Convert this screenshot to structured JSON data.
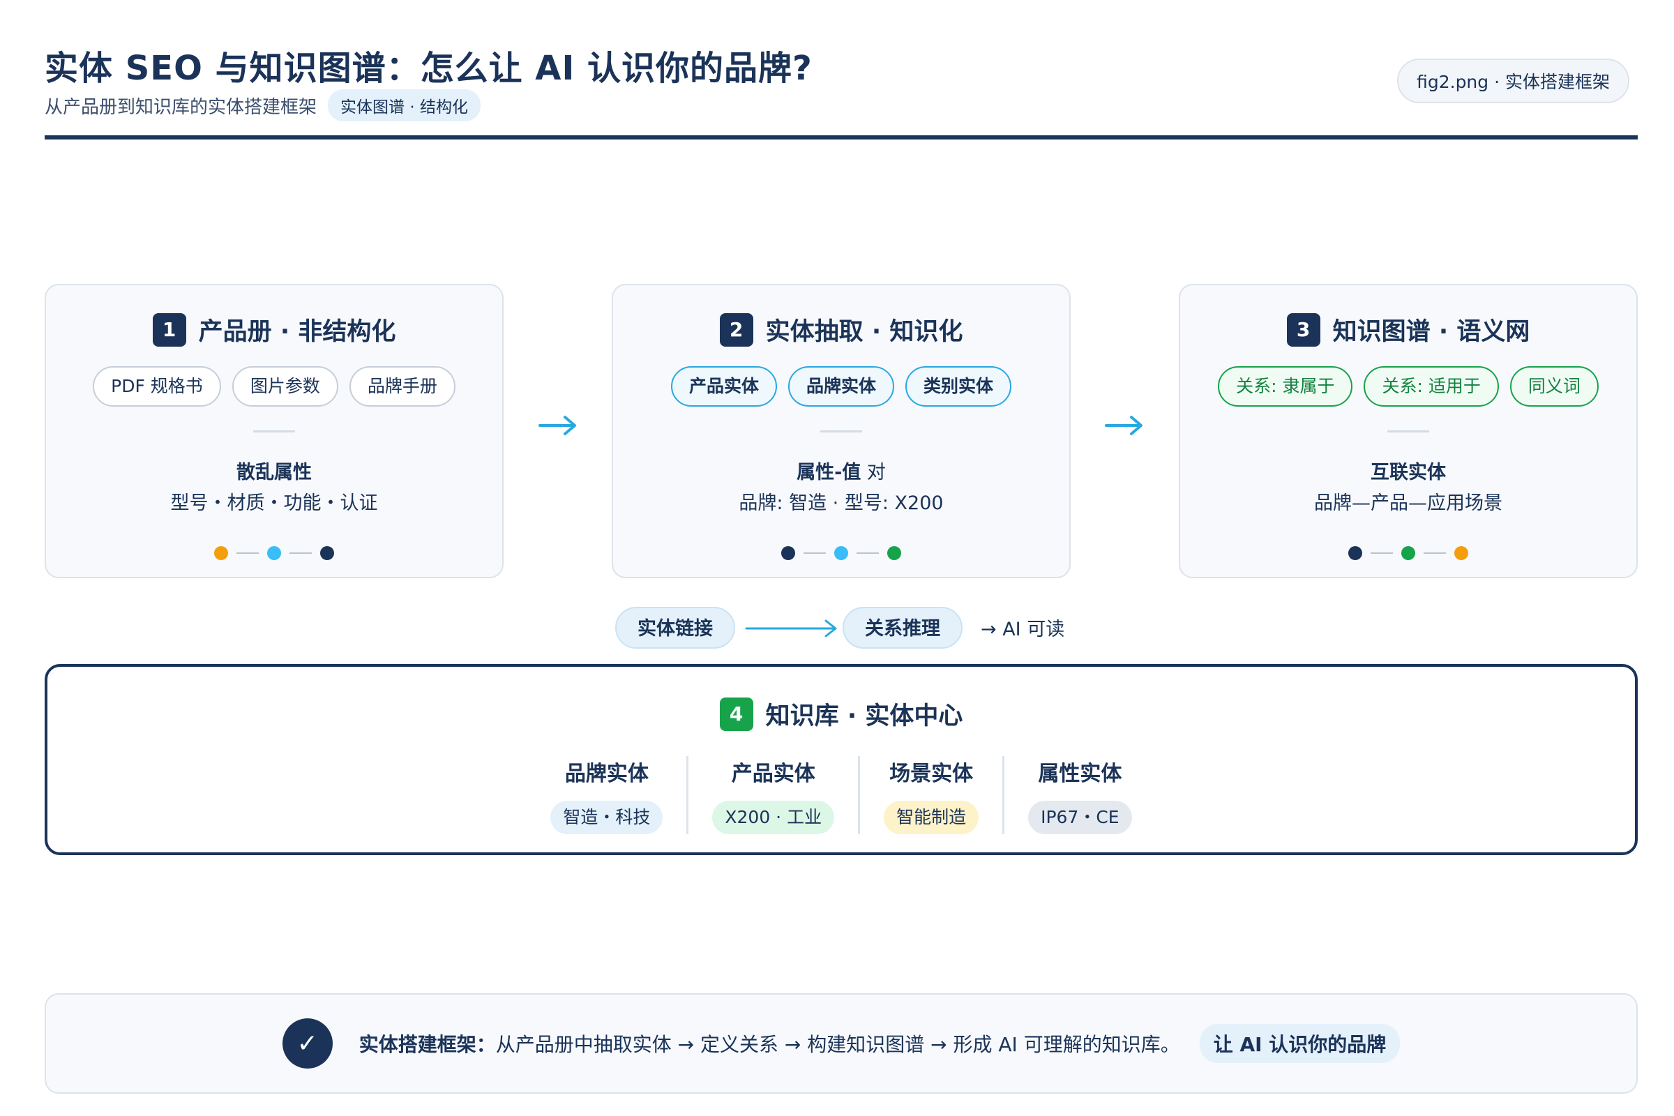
{
  "header": {
    "title": "实体 SEO 与知识图谱：怎么让 AI 认识你的品牌?",
    "subtitle": "从产品册到知识库的实体搭建框架",
    "subtitle_tag": "实体图谱 · 结构化",
    "file_label": "fig2.png · 实体搭建框架"
  },
  "steps": [
    {
      "number": "1",
      "title": "产品册 · 非结构化",
      "chips": [
        "PDF 规格书",
        "图片参数",
        "品牌手册"
      ],
      "subtitle": "散乱属性",
      "subtitle_extra": "",
      "description": "型号・材质・功能・认证",
      "dot_colors": [
        "#f59e0b",
        "#38bdf8",
        "#1b3358"
      ]
    },
    {
      "number": "2",
      "title": "实体抽取 · 知识化",
      "chips": [
        "产品实体",
        "品牌实体",
        "类别实体"
      ],
      "subtitle": "属性-值",
      "subtitle_extra": " 对",
      "description": "品牌: 智造 · 型号: X200",
      "dot_colors": [
        "#1b3358",
        "#38bdf8",
        "#16a34a"
      ]
    },
    {
      "number": "3",
      "title": "知识图谱 · 语义网",
      "chips": [
        "关系: 隶属于",
        "关系: 适用于",
        "同义词"
      ],
      "subtitle": "互联实体",
      "subtitle_extra": "",
      "description": "品牌—产品—应用场景",
      "dot_colors": [
        "#1b3358",
        "#16a34a",
        "#f59e0b"
      ]
    }
  ],
  "link_row": {
    "left_pill": "实体链接",
    "right_pill": "关系推理",
    "suffix": "→ AI 可读"
  },
  "knowledge_base": {
    "number": "4",
    "title": "知识库 · 实体中心",
    "columns": [
      {
        "name": "品牌实体",
        "tag": "智造・科技",
        "tag_color": "#e4f1fb"
      },
      {
        "name": "产品实体",
        "tag": "X200 · 工业",
        "tag_color": "#dcf7e6"
      },
      {
        "name": "场景实体",
        "tag": "智能制造",
        "tag_color": "#fdf2c8"
      },
      {
        "name": "属性实体",
        "tag": "IP67・CE",
        "tag_color": "#e4e9f0"
      }
    ]
  },
  "summary": {
    "check_icon": "✓",
    "label": "实体搭建框架：",
    "text": "从产品册中抽取实体 → 定义关系 → 构建知识图谱 → 形成 AI 可理解的知识库。",
    "highlight": "让 AI 认识你的品牌"
  },
  "colors": {
    "navy": "#1b3358",
    "accent_blue": "#29a8e0",
    "green": "#16a34a"
  }
}
